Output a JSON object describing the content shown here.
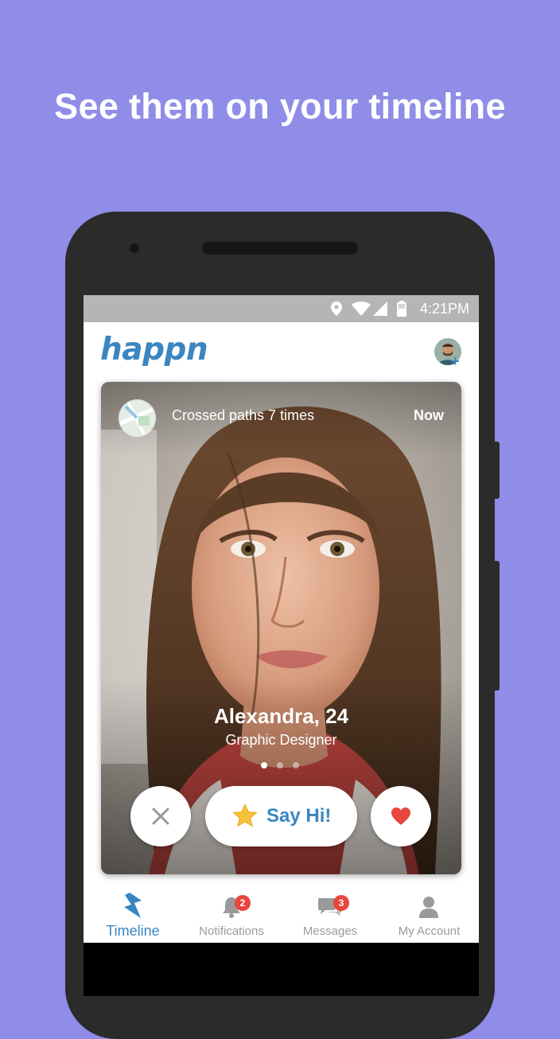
{
  "headline": "See them on your timeline",
  "status_bar": {
    "time": "4:21PM"
  },
  "app": {
    "logo": "happn"
  },
  "card": {
    "crossed_paths": "Crossed paths 7 times",
    "when": "Now",
    "name_age": "Alexandra, 24",
    "occupation": "Graphic Designer",
    "photo_count": 3,
    "active_photo": 1,
    "say_hi_label": "Say Hi!"
  },
  "tabs": [
    {
      "label": "Timeline",
      "icon": "lightning-icon",
      "active": true
    },
    {
      "label": "Notifications",
      "icon": "bell-icon",
      "badge": "2"
    },
    {
      "label": "Messages",
      "icon": "chat-bubbles-icon",
      "badge": "3"
    },
    {
      "label": "My Account",
      "icon": "person-icon"
    }
  ],
  "colors": {
    "background": "#8f8de7",
    "brand_blue": "#3a86c0",
    "heart_red": "#e8463c",
    "star_yellow": "#f6c23a",
    "badge_red": "#e8463c"
  }
}
